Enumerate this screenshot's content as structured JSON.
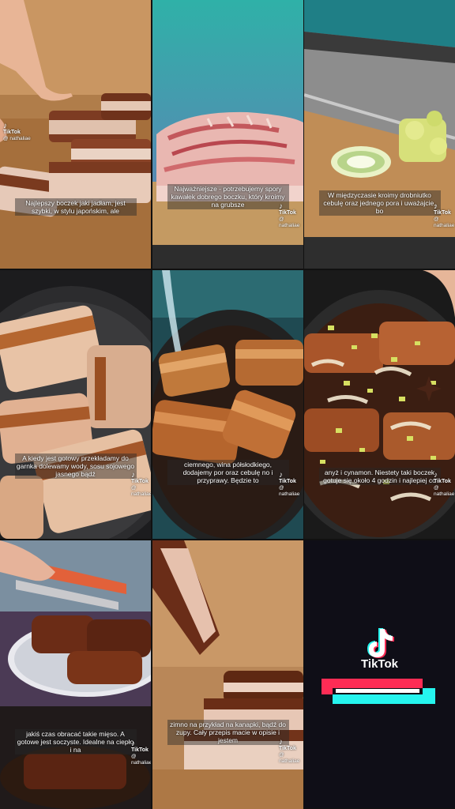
{
  "tiles": [
    {
      "caption": "Najlepszy boczek jaki jadłam, jest szybki, w stylu japońskim, ale",
      "brand": "TikTok",
      "handle": "@ nathaliae"
    },
    {
      "caption": "Najważniejsze - potrzebujemy spory kawałek dobrego boczku, który kroimy na grubsze",
      "brand": "TikTok",
      "handle": "@ nathaliae"
    },
    {
      "caption": "W międzyczasie kroimy drobniutko cebulę oraz jednego pora i uważajcie, bo",
      "brand": "TikTok",
      "handle": "@ nathaliae"
    },
    {
      "caption": "A kiedy jest gotowy przekładamy do garnka dolewamy wody, sosu sojowego jasnego bądź",
      "brand": "TikTok",
      "handle": "@ nathaliae"
    },
    {
      "caption": "ciemnego, wina półsłodkiego, dodajemy por oraz cebulę no i przyprawy. Będzie to",
      "brand": "TikTok",
      "handle": "@ nathaliae"
    },
    {
      "caption": "anyż i cynamon. Niestety taki boczek gotuje się około 4 godzin i najlepiej co",
      "brand": "TikTok",
      "handle": "@ nathaliae"
    },
    {
      "caption": "jakiś czas obracać takie mięso. A gotowe jest soczyste. Idealne na ciepło i na",
      "brand": "TikTok",
      "handle": "@ nathaliae"
    },
    {
      "caption": "zimno na przykład na kanapki, bądź do zupy. Cały przepis macie w opisie i jestem",
      "brand": "TikTok",
      "handle": "@ nathaliae"
    }
  ],
  "end_card": {
    "brand": "TikTok",
    "colors": {
      "bg": "#0f0e17",
      "cyan": "#25f4ee",
      "red": "#fe2c55"
    }
  },
  "icons": {
    "watermark": "tiktok-note-icon"
  }
}
